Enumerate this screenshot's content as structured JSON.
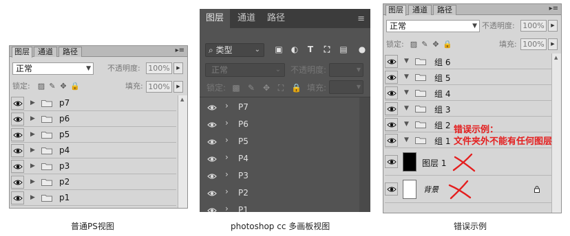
{
  "panel_a": {
    "tabs": [
      "图层",
      "通道",
      "路径"
    ],
    "blend_mode": "正常",
    "opacity_label": "不透明度:",
    "opacity_value": "100%",
    "lock_label": "锁定:",
    "fill_label": "填充:",
    "fill_value": "100%",
    "layers": [
      "p7",
      "p6",
      "p5",
      "p4",
      "p3",
      "p2",
      "p1"
    ],
    "caption": "普通PS视图"
  },
  "panel_b": {
    "tabs": [
      "图层",
      "通道",
      "路径"
    ],
    "filter_label": "类型",
    "blend_mode": "正常",
    "opacity_label": "不透明度:",
    "lock_label": "锁定:",
    "fill_label": "填充:",
    "layers": [
      "P7",
      "P6",
      "P5",
      "P4",
      "P3",
      "P2",
      "P1"
    ],
    "caption": "photoshop cc 多画板视图"
  },
  "panel_c": {
    "tabs": [
      "图层",
      "通道",
      "路径"
    ],
    "blend_mode": "正常",
    "opacity_label": "不透明度:",
    "opacity_value": "100%",
    "lock_label": "锁定:",
    "fill_label": "填充:",
    "fill_value": "100%",
    "groups": [
      "组 6",
      "组 5",
      "组 4",
      "组 3",
      "组 2",
      "组 1"
    ],
    "layer_name": "图层 1",
    "background_name": "背景",
    "error_title": "错误示例：",
    "error_desc": "文件夹外不能有任何图层",
    "caption": "错误示例"
  },
  "colors": {
    "error_red": "#e41e1e",
    "dark_panel": "#535353",
    "light_panel": "#d6d6d6"
  }
}
